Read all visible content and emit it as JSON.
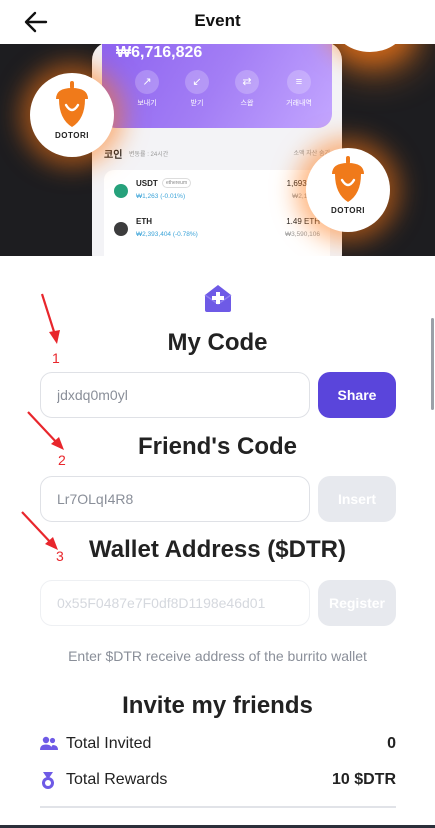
{
  "header": {
    "title": "Event"
  },
  "banner": {
    "balance": "₩6,716,826",
    "actions": [
      "보내기",
      "받기",
      "스왑",
      "거래내역"
    ],
    "coins_label": "코인",
    "coins_sub": "변동률 : 24시간",
    "hide_small": "소액 자산 숨기",
    "coins": [
      {
        "name": "USDT",
        "tag": "ethereum",
        "change": "₩1,263 (-0.01%)",
        "amount": "1,693 US",
        "value": "₩2,140,2"
      },
      {
        "name": "ETH",
        "tag": "",
        "change": "₩2,393,404 (-0.78%)",
        "amount": "1.49 ETH",
        "value": "₩3,590,106"
      }
    ],
    "dotori_label": "DOTORI"
  },
  "steps": {
    "one": "1",
    "two": "2",
    "three": "3"
  },
  "my_code": {
    "title": "My Code",
    "value": "jdxdq0m0yl",
    "share_label": "Share"
  },
  "friend_code": {
    "title": "Friend's Code",
    "value": "Lr7OLqI4R8",
    "insert_label": "Insert"
  },
  "wallet": {
    "title": "Wallet Address ($DTR)",
    "placeholder": "0x55F0487e7F0df8D1198e46d01",
    "register_label": "Register",
    "helper": "Enter $DTR receive address of the burrito wallet"
  },
  "invite": {
    "title": "Invite my friends",
    "total_invited_label": "Total Invited",
    "total_invited_value": "0",
    "total_rewards_label": "Total Rewards",
    "total_rewards_value": "10 $DTR"
  },
  "colors": {
    "accent": "#5a45db",
    "disabled": "#e7e9ee",
    "annotation": "#e8262c"
  }
}
